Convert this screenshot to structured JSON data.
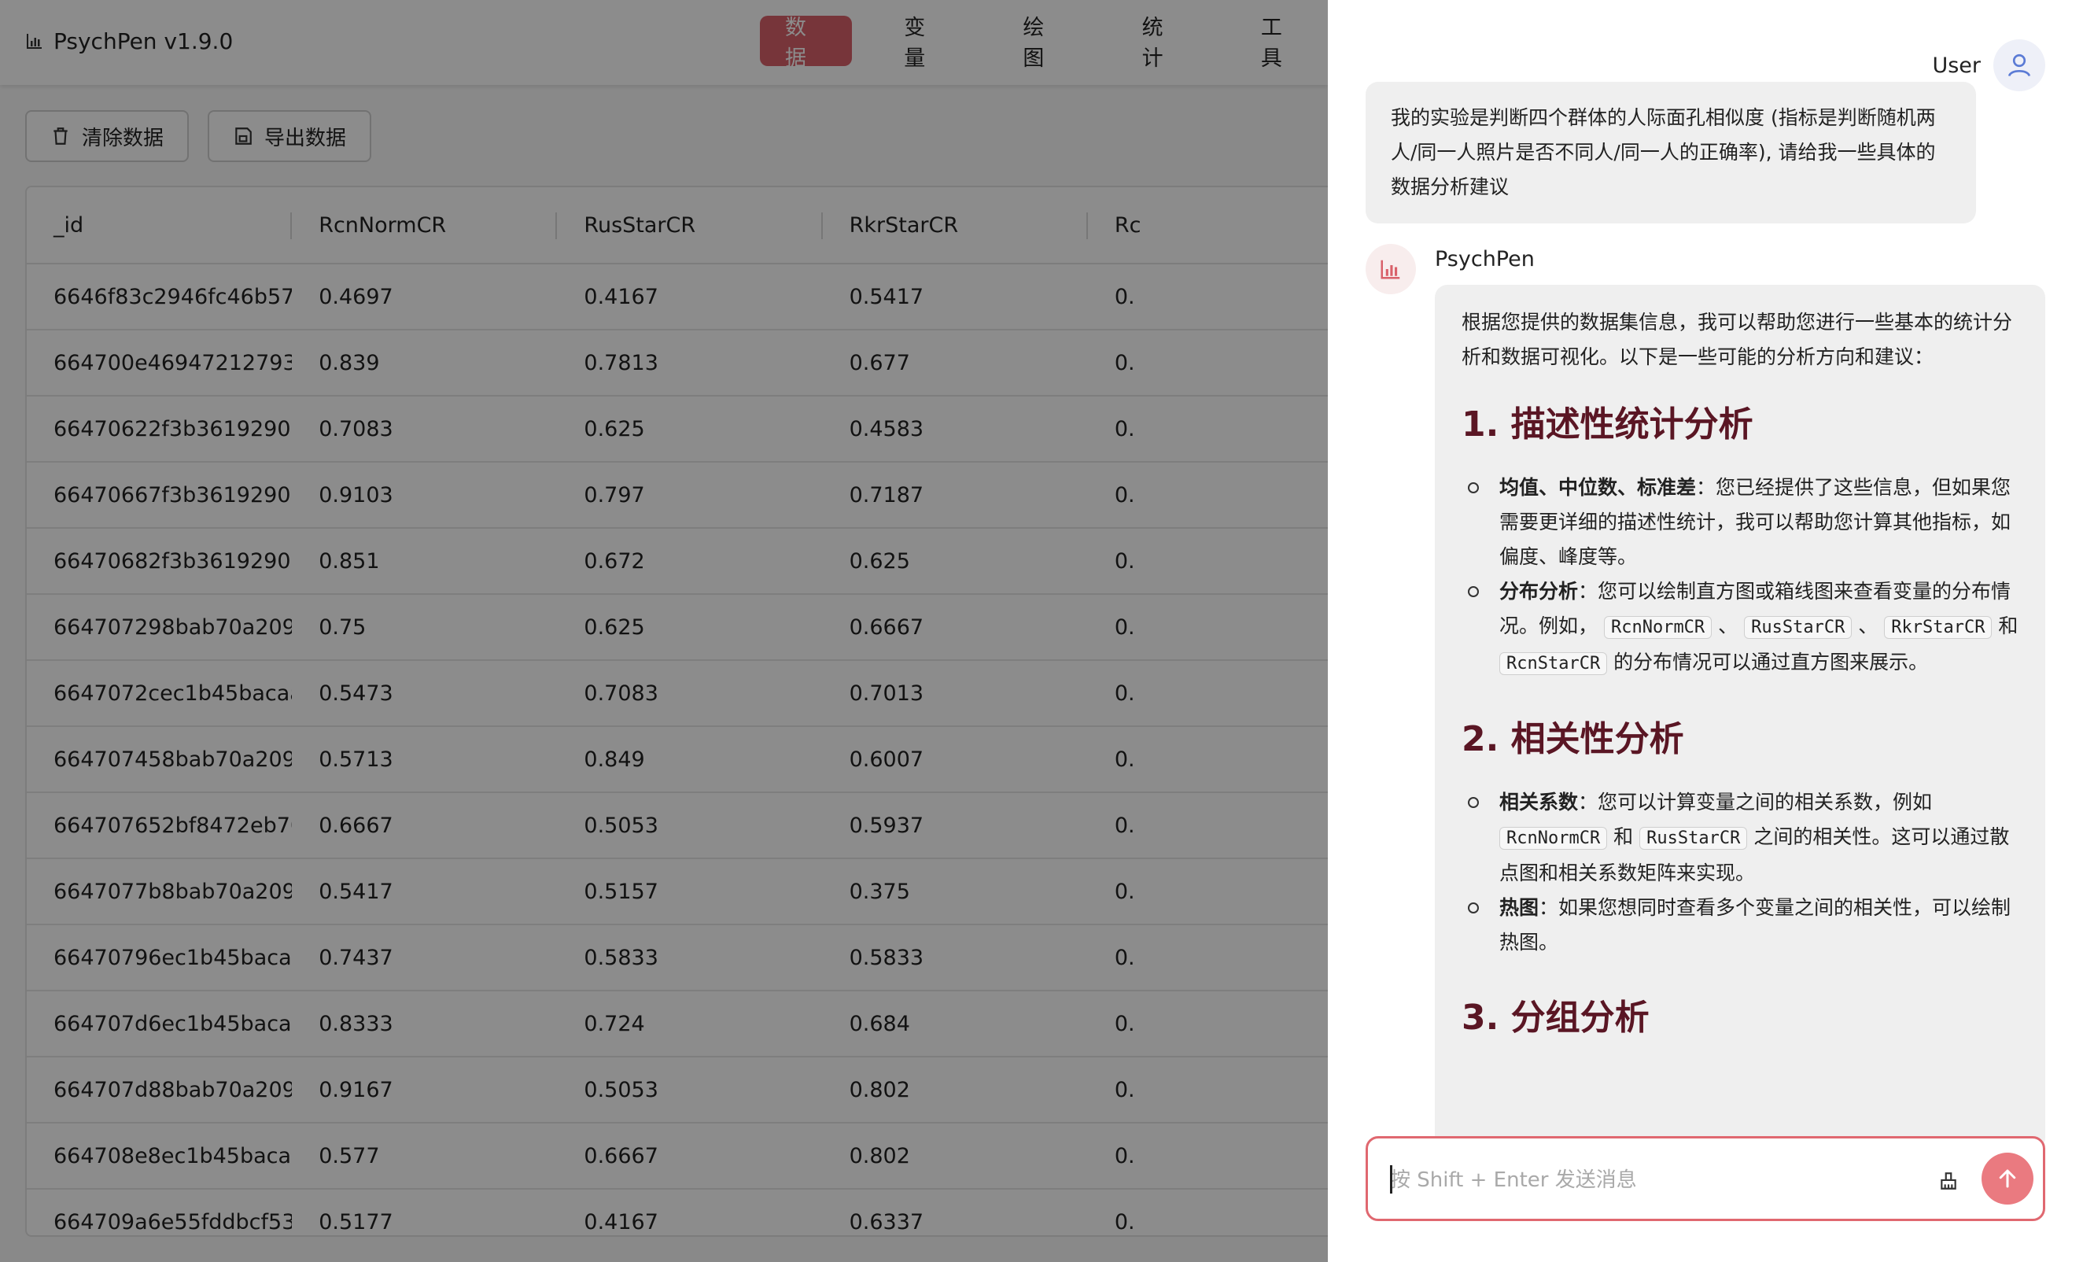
{
  "app": {
    "title": "PsychPen v1.9.0",
    "nav": [
      {
        "label": "数据",
        "active": true
      },
      {
        "label": "变量",
        "active": false
      },
      {
        "label": "绘图",
        "active": false
      },
      {
        "label": "统计",
        "active": false
      },
      {
        "label": "工具",
        "active": false
      }
    ],
    "toolbar": {
      "clear_label": "清除数据",
      "export_label": "导出数据"
    },
    "table": {
      "columns": [
        "_id",
        "RcnNormCR",
        "RusStarCR",
        "RkrStarCR",
        "Rc"
      ],
      "rows": [
        [
          "6646f83c2946fc46b57...",
          "0.4697",
          "0.4167",
          "0.5417",
          "0."
        ],
        [
          "664700e46947212793...",
          "0.839",
          "0.7813",
          "0.677",
          "0."
        ],
        [
          "66470622f3b36192905...",
          "0.7083",
          "0.625",
          "0.4583",
          "0."
        ],
        [
          "66470667f3b36192905...",
          "0.9103",
          "0.797",
          "0.7187",
          "0."
        ],
        [
          "66470682f3b3619290...",
          "0.851",
          "0.672",
          "0.625",
          "0."
        ],
        [
          "664707298bab70a209...",
          "0.75",
          "0.625",
          "0.6667",
          "0."
        ],
        [
          "6647072cec1b45bacaa...",
          "0.5473",
          "0.7083",
          "0.7013",
          "0."
        ],
        [
          "664707458bab70a209...",
          "0.5713",
          "0.849",
          "0.6007",
          "0."
        ],
        [
          "664707652bf8472eb70...",
          "0.6667",
          "0.5053",
          "0.5937",
          "0."
        ],
        [
          "6647077b8bab70a209...",
          "0.5417",
          "0.5157",
          "0.375",
          "0."
        ],
        [
          "66470796ec1b45bacaa...",
          "0.7437",
          "0.5833",
          "0.5833",
          "0."
        ],
        [
          "664707d6ec1b45bacaa...",
          "0.8333",
          "0.724",
          "0.684",
          "0."
        ],
        [
          "664707d88bab70a209...",
          "0.9167",
          "0.5053",
          "0.802",
          "0."
        ],
        [
          "664708e8ec1b45bacaa...",
          "0.577",
          "0.6667",
          "0.802",
          "0."
        ],
        [
          "664709a6e55fddbcf53...",
          "0.5177",
          "0.4167",
          "0.6337",
          "0."
        ]
      ]
    }
  },
  "chat": {
    "user_name": "User",
    "user_message": "我的实验是判断四个群体的人际面孔相似度 (指标是判断随机两人/同一人照片是否不同人/同一人的正确率), 请给我一些具体的数据分析建议",
    "bot_name": "PsychPen",
    "bot_intro": "根据您提供的数据集信息，我可以帮助您进行一些基本的统计分析和数据可视化。以下是一些可能的分析方向和建议：",
    "section1_title": "1. 描述性统计分析",
    "s1_item1_bold": "均值、中位数、标准差",
    "s1_item1_text": "：您已经提供了这些信息，但如果您需要更详细的描述性统计，我可以帮助您计算其他指标，如偏度、峰度等。",
    "s1_item2_bold": "分布分析",
    "s1_item2_text1": "：您可以绘制直方图或箱线图来查看变量的分布情况。例如，",
    "s1_item2_sep1": "、",
    "s1_item2_sep2": "、",
    "s1_item2_sep3": "和",
    "s1_item2_text2": "的分布情况可以通过直方图来展示。",
    "section2_title": "2. 相关性分析",
    "s2_item1_bold": "相关系数",
    "s2_item1_text1": "：您可以计算变量之间的相关系数，例如",
    "s2_item1_sep": "和",
    "s2_item1_text2": "之间的相关性。这可以通过散点图和相关系数矩阵来实现。",
    "s2_item2_bold": "热图",
    "s2_item2_text": "：如果您想同时查看多个变量之间的相关性，可以绘制热图。",
    "section3_title": "3. 分组分析",
    "code_terms": [
      "RcnNormCR",
      "RusStarCR",
      "RkrStarCR",
      "RcnStarCR"
    ],
    "input_placeholder": "按 Shift + Enter 发送消息"
  },
  "colors": {
    "accent": "#d9616a",
    "heading": "#5a1624",
    "send_button": "#ea7a80"
  }
}
